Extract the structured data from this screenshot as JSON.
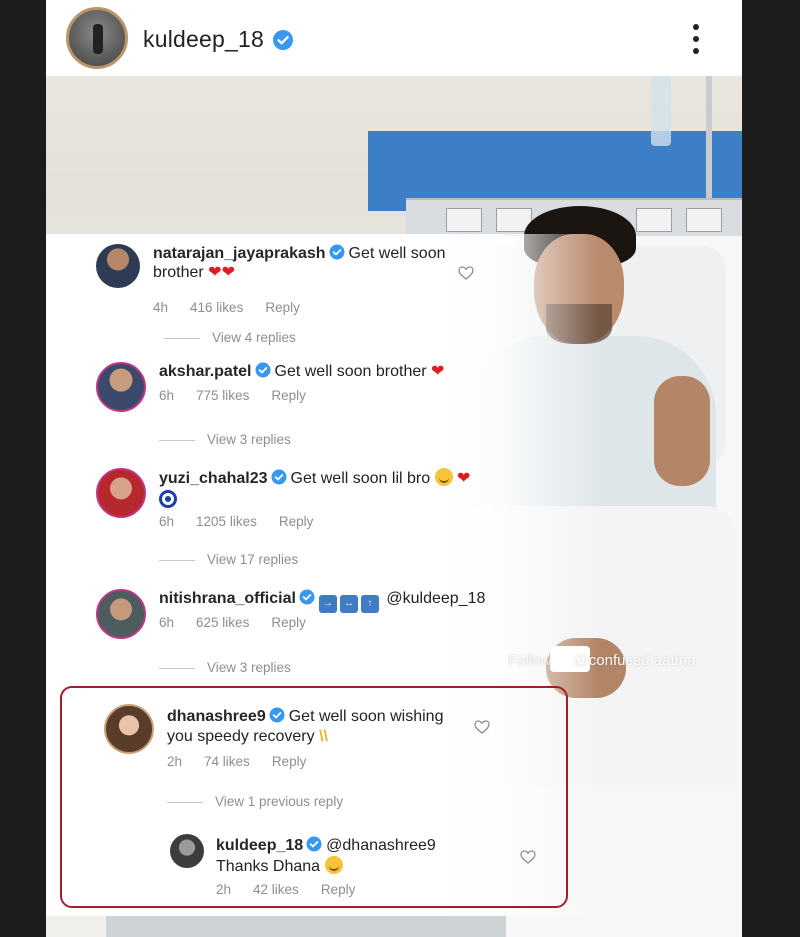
{
  "post": {
    "username": "kuldeep_18"
  },
  "comments": [
    {
      "username": "natarajan_jayaprakash",
      "text_line1": "Get well soon",
      "text_line2": "brother",
      "time": "4h",
      "likes": "416 likes",
      "reply": "Reply",
      "view_replies": "View 4 replies"
    },
    {
      "username": "akshar.patel",
      "text_line1": "Get well soon brother",
      "time": "6h",
      "likes": "775 likes",
      "reply": "Reply",
      "view_replies": "View 3 replies"
    },
    {
      "username": "yuzi_chahal23",
      "text_line1": "Get well soon lil bro",
      "time": "6h",
      "likes": "1205 likes",
      "reply": "Reply",
      "view_replies": "View 17 replies"
    },
    {
      "username": "nitishrana_official",
      "text_line1": "@kuldeep_18",
      "time": "6h",
      "likes": "625 likes",
      "reply": "Reply",
      "view_replies": "View 3 replies"
    },
    {
      "username": "dhanashree9",
      "text_line1": "Get well soon wishing",
      "text_line2": "you speedy recovery",
      "time": "2h",
      "likes": "74 likes",
      "reply": "Reply",
      "view_replies": "View 1 previous reply"
    },
    {
      "username": "kuldeep_18",
      "text_line1": "@dhanashree9",
      "text_line2": "Thanks Dhana",
      "time": "2h",
      "likes": "42 likes",
      "reply": "Reply"
    }
  ],
  "watermark": {
    "prefix": "Follow",
    "handle": "@confused.aatma"
  },
  "colors": {
    "verified_badge": "#3897f0",
    "highlight_border": "#9c1f2c",
    "meta_text": "#8e8e8e",
    "heart_emoji": "#e01b24"
  },
  "icons": [
    "verified-badge-icon",
    "more-options-icon",
    "heart-outline-icon",
    "red-heart-emoji",
    "grinning-face-emoji",
    "nazar-amulet-emoji",
    "raising-hands-emoji",
    "soon-arrow-emoji",
    "on-arrow-emoji",
    "top-arrow-emoji",
    "instagram-icon"
  ]
}
